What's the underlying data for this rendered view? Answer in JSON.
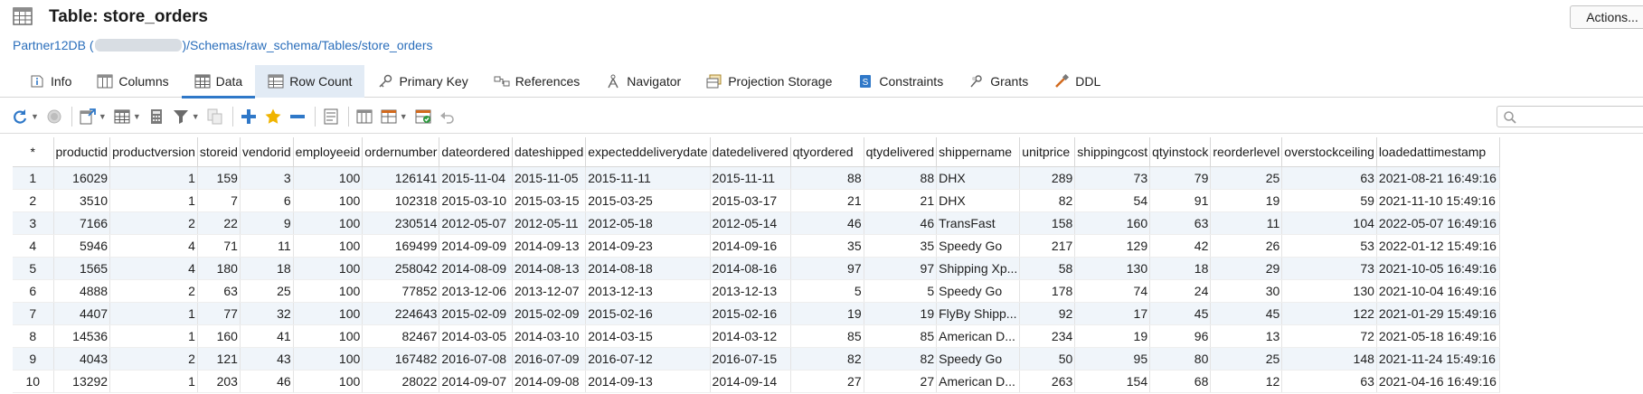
{
  "title": "Table: store_orders",
  "actions_label": "Actions...",
  "breadcrumb": {
    "db": "Partner12DB",
    "open": " (",
    "path": ")/Schemas/raw_schema/Tables/store_orders"
  },
  "tabs": [
    {
      "label": "Info",
      "icon": "info-icon"
    },
    {
      "label": "Columns",
      "icon": "columns-icon"
    },
    {
      "label": "Data",
      "icon": "data-grid-icon"
    },
    {
      "label": "Row Count",
      "icon": "row-count-icon"
    },
    {
      "label": "Primary Key",
      "icon": "key-icon"
    },
    {
      "label": "References",
      "icon": "references-icon"
    },
    {
      "label": "Navigator",
      "icon": "navigator-icon"
    },
    {
      "label": "Projection Storage",
      "icon": "projection-icon"
    },
    {
      "label": "Constraints",
      "icon": "constraints-icon"
    },
    {
      "label": "Grants",
      "icon": "grants-icon"
    },
    {
      "label": "DDL",
      "icon": "ddl-icon"
    }
  ],
  "grid": {
    "corner": "*",
    "columns": [
      "productid",
      "productversion",
      "storeid",
      "vendorid",
      "employeeid",
      "ordernumber",
      "dateordered",
      "dateshipped",
      "expecteddeliverydate",
      "datedelivered",
      "qtyordered",
      "qtydelivered",
      "shippername",
      "unitprice",
      "shippingcost",
      "qtyinstock",
      "reorderlevel",
      "overstockceiling",
      "loadedattimestamp"
    ],
    "rows": [
      [
        "1",
        "16029",
        "1",
        "159",
        "3",
        "100",
        "126141",
        "2015-11-04",
        "2015-11-05",
        "2015-11-11",
        "2015-11-11",
        "88",
        "88",
        "DHX",
        "289",
        "73",
        "79",
        "25",
        "63",
        "2021-08-21 16:49:16"
      ],
      [
        "2",
        "3510",
        "1",
        "7",
        "6",
        "100",
        "102318",
        "2015-03-10",
        "2015-03-15",
        "2015-03-25",
        "2015-03-17",
        "21",
        "21",
        "DHX",
        "82",
        "54",
        "91",
        "19",
        "59",
        "2021-11-10 15:49:16"
      ],
      [
        "3",
        "7166",
        "2",
        "22",
        "9",
        "100",
        "230514",
        "2012-05-07",
        "2012-05-11",
        "2012-05-18",
        "2012-05-14",
        "46",
        "46",
        "TransFast",
        "158",
        "160",
        "63",
        "11",
        "104",
        "2022-05-07 16:49:16"
      ],
      [
        "4",
        "5946",
        "4",
        "71",
        "11",
        "100",
        "169499",
        "2014-09-09",
        "2014-09-13",
        "2014-09-23",
        "2014-09-16",
        "35",
        "35",
        "Speedy Go",
        "217",
        "129",
        "42",
        "26",
        "53",
        "2022-01-12 15:49:16"
      ],
      [
        "5",
        "1565",
        "4",
        "180",
        "18",
        "100",
        "258042",
        "2014-08-09",
        "2014-08-13",
        "2014-08-18",
        "2014-08-16",
        "97",
        "97",
        "Shipping Xp...",
        "58",
        "130",
        "18",
        "29",
        "73",
        "2021-10-05 16:49:16"
      ],
      [
        "6",
        "4888",
        "2",
        "63",
        "25",
        "100",
        "77852",
        "2013-12-06",
        "2013-12-07",
        "2013-12-13",
        "2013-12-13",
        "5",
        "5",
        "Speedy Go",
        "178",
        "74",
        "24",
        "30",
        "130",
        "2021-10-04 16:49:16"
      ],
      [
        "7",
        "4407",
        "1",
        "77",
        "32",
        "100",
        "224643",
        "2015-02-09",
        "2015-02-09",
        "2015-02-16",
        "2015-02-16",
        "19",
        "19",
        "FlyBy Shipp...",
        "92",
        "17",
        "45",
        "45",
        "122",
        "2021-01-29 15:49:16"
      ],
      [
        "8",
        "14536",
        "1",
        "160",
        "41",
        "100",
        "82467",
        "2014-03-05",
        "2014-03-10",
        "2014-03-15",
        "2014-03-12",
        "85",
        "85",
        "American D...",
        "234",
        "19",
        "96",
        "13",
        "72",
        "2021-05-18 16:49:16"
      ],
      [
        "9",
        "4043",
        "2",
        "121",
        "43",
        "100",
        "167482",
        "2016-07-08",
        "2016-07-09",
        "2016-07-12",
        "2016-07-15",
        "82",
        "82",
        "Speedy Go",
        "50",
        "95",
        "80",
        "25",
        "148",
        "2021-11-24 15:49:16"
      ],
      [
        "10",
        "13292",
        "1",
        "203",
        "46",
        "100",
        "28022",
        "2014-09-07",
        "2014-09-08",
        "2014-09-13",
        "2014-09-14",
        "27",
        "27",
        "American D...",
        "263",
        "154",
        "68",
        "12",
        "63",
        "2021-04-16 16:49:16"
      ]
    ]
  }
}
